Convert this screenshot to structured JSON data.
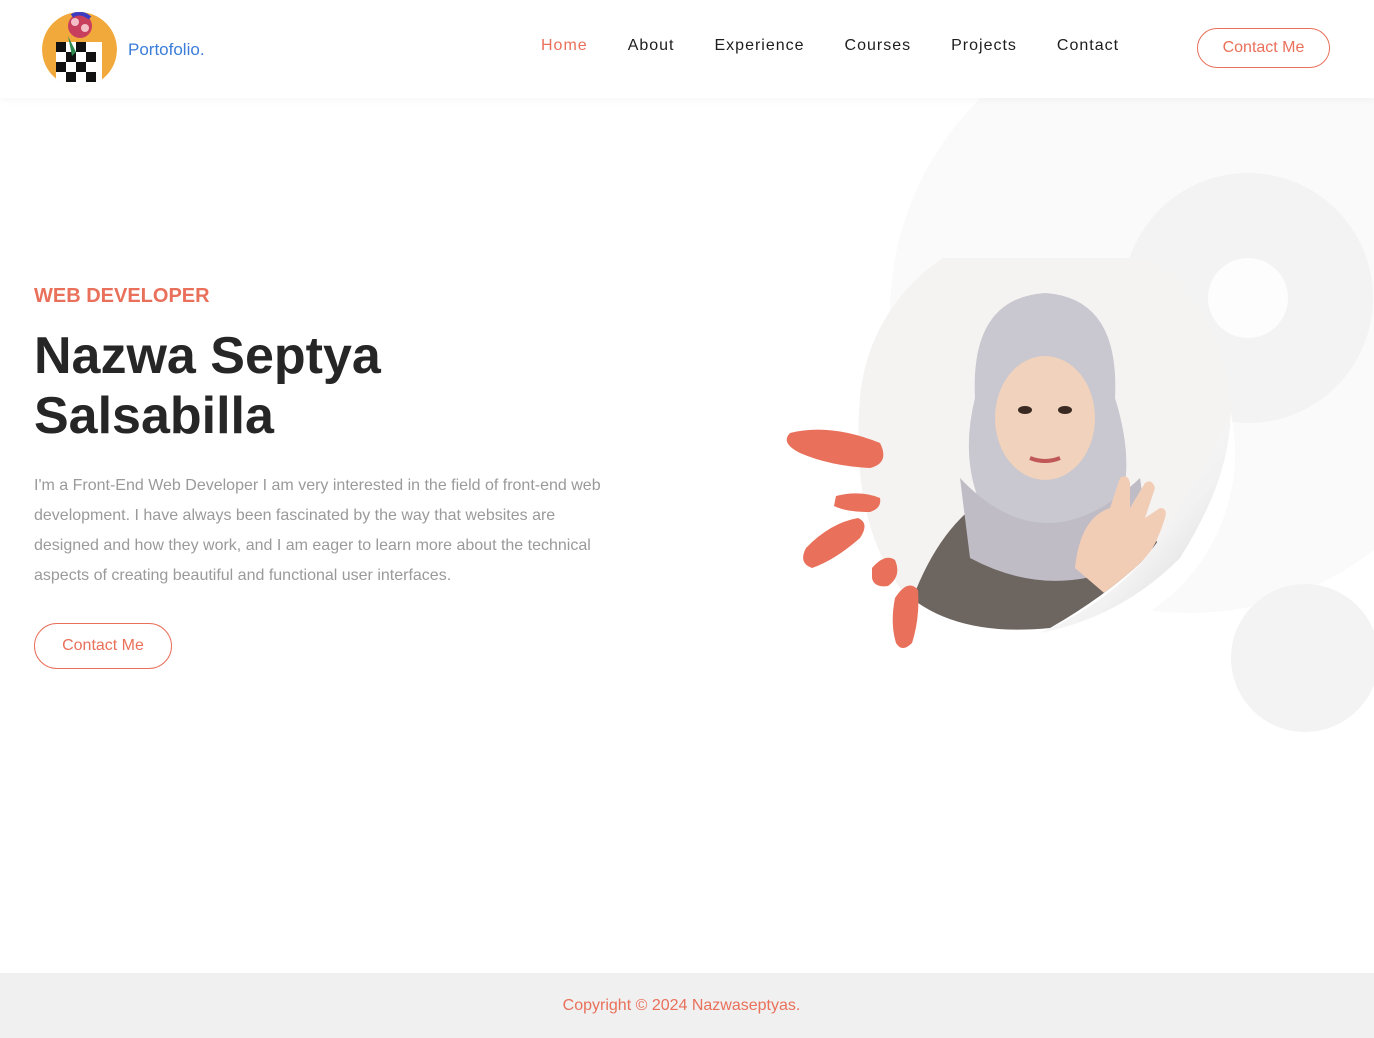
{
  "header": {
    "brand": "Portofolio.",
    "nav": [
      "Home",
      "About",
      "Experience",
      "Courses",
      "Projects",
      "Contact"
    ],
    "active_nav": "Home",
    "cta_label": "Contact Me"
  },
  "hero": {
    "subtitle": "WEB DEVELOPER",
    "name_line1": "Nazwa Septya",
    "name_line2": "Salsabilla",
    "description": "I'm a Front-End Web Developer I am very interested in the field of front-end web development. I have always been fascinated by the way that websites are designed and how they work, and I am eager to learn more about the technical aspects of creating beautiful and functional user interfaces.",
    "cta_label": "Contact Me"
  },
  "footer": {
    "copyright": "Copyright © 2024 Nazwaseptyas."
  },
  "colors": {
    "accent": "#e9705a",
    "brand": "#3b7dd8",
    "text_dark": "#262626",
    "text_muted": "#9a9a9a",
    "footer_bg": "#f0f0f0"
  },
  "icons": {
    "logo": "avatar-logo-icon",
    "portrait": "profile-photo",
    "splash": "paint-splash-decoration"
  }
}
